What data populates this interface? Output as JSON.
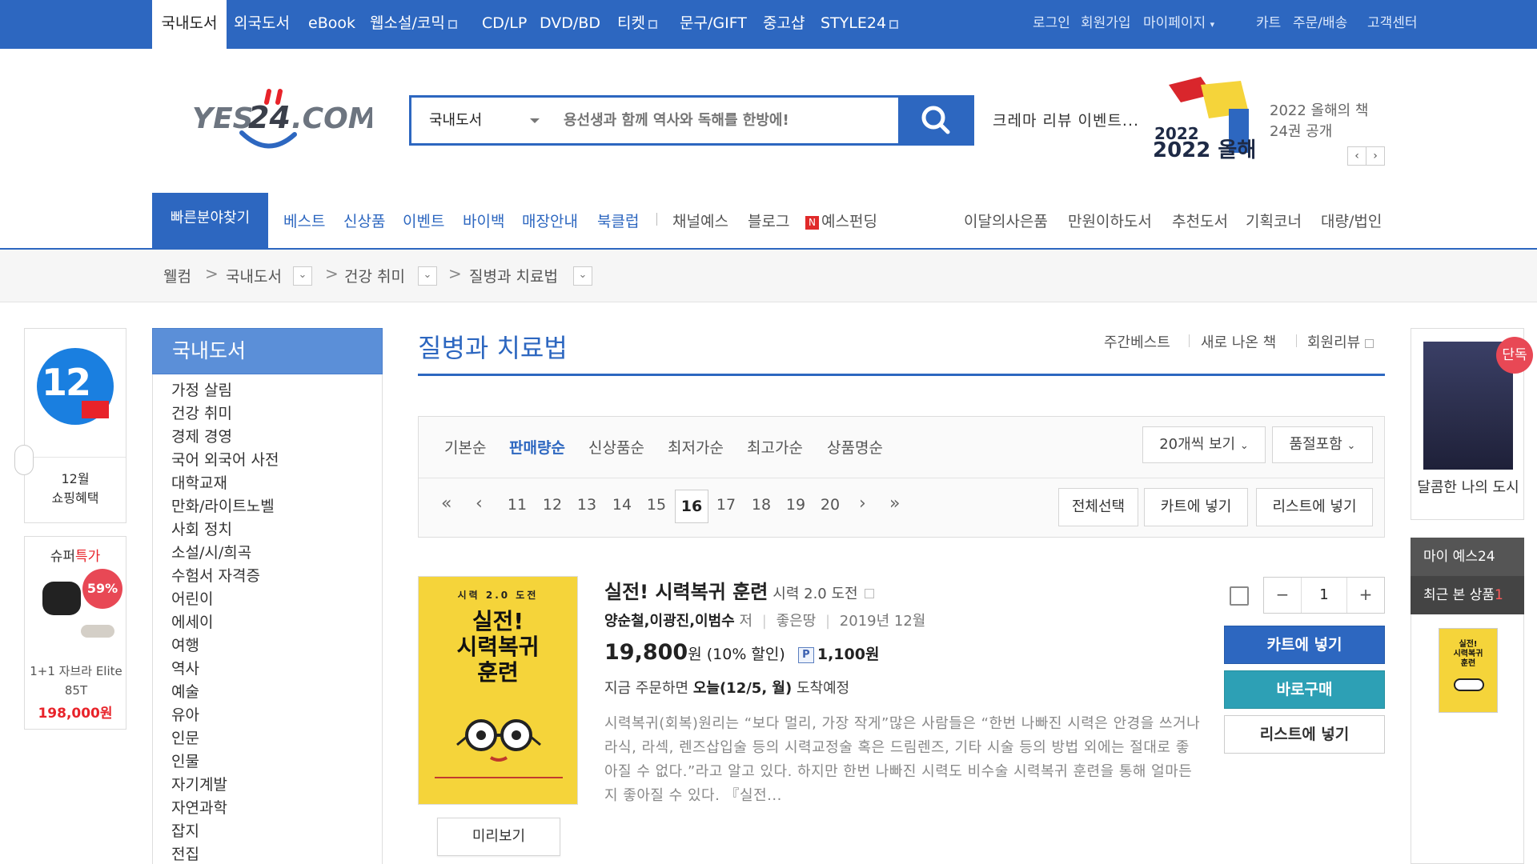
{
  "topbar": {
    "categories": [
      "국내도서",
      "외국도서",
      "eBook",
      "웹소설/코믹",
      "CD/LP",
      "DVD/BD",
      "티켓",
      "문구/GIFT",
      "중고샵",
      "STYLE24"
    ],
    "util_links": [
      "로그인",
      "회원가입",
      "마이페이지",
      "카트",
      "주문/배송",
      "고객센터"
    ]
  },
  "header": {
    "logo_text": "YES24.COM",
    "search_category": "국내도서",
    "search_placeholder": "용선생과 함께 역사와 독해를 한방에!",
    "promo_text": "크레마 리뷰 이벤트...",
    "promo_title": "2022 올해의 책 24권 공개",
    "promo_image_label": "2022 올해의 책"
  },
  "nav": {
    "quick_find": "빠른분야찾기",
    "items_left": [
      "베스트",
      "신상품",
      "이벤트",
      "바이백",
      "매장안내",
      "북클럽"
    ],
    "items_mid": [
      "채널예스",
      "블로그",
      "예스펀딩"
    ],
    "funding_badge": "N",
    "items_right": [
      "이달의사은품",
      "만원이하도서",
      "추천도서",
      "기획코너",
      "대량/법인"
    ]
  },
  "breadcrumb": [
    "웰컴",
    "국내도서",
    "건강 취미",
    "질병과 치료법"
  ],
  "left_promos": {
    "promo1_badge": "12",
    "promo1_label": "12월\n쇼핑혜택",
    "promo2_title": "슈퍼특가",
    "promo2_title_main": "슈퍼",
    "promo2_title_accent": "특가",
    "promo2_discount": "59%",
    "promo2_name": "1+1 자브라 Elite 85T",
    "promo2_price": "198,000원"
  },
  "category": {
    "title": "국내도서",
    "items": [
      "가정 살림",
      "건강 취미",
      "경제 경영",
      "국어 외국어 사전",
      "대학교재",
      "만화/라이트노벨",
      "사회 정치",
      "소설/시/희곡",
      "수험서 자격증",
      "어린이",
      "에세이",
      "여행",
      "역사",
      "예술",
      "유아",
      "인문",
      "인물",
      "자기계발",
      "자연과학",
      "잡지",
      "전집"
    ]
  },
  "main": {
    "title": "질병과 치료법",
    "top_links": [
      "주간베스트",
      "새로 나온 책",
      "회원리뷰"
    ],
    "sort_options": [
      "기본순",
      "판매량순",
      "신상품순",
      "최저가순",
      "최고가순",
      "상품명순"
    ],
    "active_sort": "판매량순",
    "view_count": "20개씩 보기",
    "soldout_filter": "품절포함",
    "pages": [
      "11",
      "12",
      "13",
      "14",
      "15",
      "16",
      "17",
      "18",
      "19",
      "20"
    ],
    "current_page": "16",
    "actions": [
      "전체선택",
      "카트에 넣기",
      "리스트에 넣기"
    ]
  },
  "product": {
    "title": "실전! 시력복귀 훈련",
    "subtitle": "시력 2.0 도전",
    "authors": "양순철,이광진,이범수",
    "author_suffix": "저",
    "publisher": "좋은땅",
    "date": "2019년 12월",
    "price": "19,800",
    "price_unit": "원",
    "discount": "(10% 할인)",
    "points_icon": "P",
    "points": "1,100원",
    "delivery_prefix": "지금 주문하면",
    "delivery_date": "오늘(12/5, 월)",
    "delivery_suffix": "도착예정",
    "description": "시력복귀(회복)원리는 “보다 멀리, 가장 작게”많은 사람들은 “한번 나빠진 시력은 안경을 쓰거나 라식, 라섹, 렌즈삽입술 등의 시력교정술 혹은 드림렌즈, 기타 시술 등의 방법 외에는 절대로 좋아질 수 없다.”라고 알고 있다. 하지만 한번 나빠진 시력도 비수술 시력복귀 훈련을 통해 얼마든지 좋아질 수 있다. 『실전...",
    "cover_top": "시력 2.0 도전",
    "cover_title": "실전!\n시력복귀\n훈련",
    "preview_btn": "미리보기",
    "qty": "1",
    "qty_minus": "−",
    "qty_plus": "+",
    "cart_btn": "카트에 넣기",
    "buy_btn": "바로구매",
    "list_btn": "리스트에 넣기"
  },
  "right_rail": {
    "book_title": "달콤한 나의 도시",
    "exclusive": "단독",
    "my_yes24": "마이 예스24",
    "recent_label": "최근 본 상품",
    "recent_count": "1"
  },
  "colors": {
    "brand_blue": "#2d67c0",
    "buy_teal": "#2da0b5",
    "promo_red": "#e84855"
  }
}
